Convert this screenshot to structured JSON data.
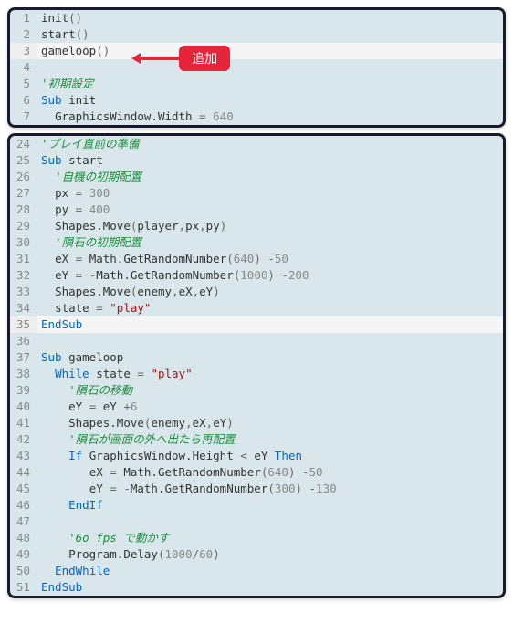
{
  "callout": {
    "label": "追加"
  },
  "top": [
    {
      "n": 1,
      "tokens": [
        [
          "fn",
          "init"
        ],
        [
          "op",
          "()"
        ]
      ]
    },
    {
      "n": 2,
      "tokens": [
        [
          "fn",
          "start"
        ],
        [
          "op",
          "()"
        ]
      ]
    },
    {
      "n": 3,
      "hl": true,
      "tokens": [
        [
          "fn",
          "gameloop"
        ],
        [
          "op",
          "()"
        ]
      ]
    },
    {
      "n": 4,
      "tokens": []
    },
    {
      "n": 5,
      "tokens": [
        [
          "cm",
          "'初期設定"
        ]
      ]
    },
    {
      "n": 6,
      "tokens": [
        [
          "kw",
          "Sub "
        ],
        [
          "fn",
          "init"
        ]
      ]
    },
    {
      "n": 7,
      "tokens": [
        [
          "p",
          "  "
        ],
        [
          "fn",
          "GraphicsWindow.Width "
        ],
        [
          "op",
          "= "
        ],
        [
          "num",
          "640"
        ]
      ]
    }
  ],
  "bottom": [
    {
      "n": 24,
      "tokens": [
        [
          "cm",
          "'プレイ直前の準備"
        ]
      ]
    },
    {
      "n": 25,
      "tokens": [
        [
          "kw",
          "Sub "
        ],
        [
          "fn",
          "start"
        ]
      ]
    },
    {
      "n": 26,
      "tokens": [
        [
          "p",
          "  "
        ],
        [
          "cm",
          "'自機の初期配置"
        ]
      ]
    },
    {
      "n": 27,
      "tokens": [
        [
          "p",
          "  "
        ],
        [
          "fn",
          "px "
        ],
        [
          "op",
          "= "
        ],
        [
          "num",
          "300"
        ]
      ]
    },
    {
      "n": 28,
      "tokens": [
        [
          "p",
          "  "
        ],
        [
          "fn",
          "py "
        ],
        [
          "op",
          "= "
        ],
        [
          "num",
          "400"
        ]
      ]
    },
    {
      "n": 29,
      "tokens": [
        [
          "p",
          "  "
        ],
        [
          "fn",
          "Shapes.Move"
        ],
        [
          "op",
          "("
        ],
        [
          "fn",
          "player"
        ],
        [
          "op",
          ","
        ],
        [
          "fn",
          "px"
        ],
        [
          "op",
          ","
        ],
        [
          "fn",
          "py"
        ],
        [
          "op",
          ")"
        ]
      ]
    },
    {
      "n": 30,
      "tokens": [
        [
          "p",
          "  "
        ],
        [
          "cm",
          "'隕石の初期配置"
        ]
      ]
    },
    {
      "n": 31,
      "tokens": [
        [
          "p",
          "  "
        ],
        [
          "fn",
          "eX "
        ],
        [
          "op",
          "= "
        ],
        [
          "fn",
          "Math.GetRandomNumber"
        ],
        [
          "op",
          "("
        ],
        [
          "num",
          "640"
        ],
        [
          "op",
          ") -"
        ],
        [
          "num",
          "50"
        ]
      ]
    },
    {
      "n": 32,
      "tokens": [
        [
          "p",
          "  "
        ],
        [
          "fn",
          "eY "
        ],
        [
          "op",
          "= -"
        ],
        [
          "fn",
          "Math.GetRandomNumber"
        ],
        [
          "op",
          "("
        ],
        [
          "num",
          "1000"
        ],
        [
          "op",
          ") -"
        ],
        [
          "num",
          "200"
        ]
      ]
    },
    {
      "n": 33,
      "tokens": [
        [
          "p",
          "  "
        ],
        [
          "fn",
          "Shapes.Move"
        ],
        [
          "op",
          "("
        ],
        [
          "fn",
          "enemy"
        ],
        [
          "op",
          ","
        ],
        [
          "fn",
          "eX"
        ],
        [
          "op",
          ","
        ],
        [
          "fn",
          "eY"
        ],
        [
          "op",
          ")"
        ]
      ]
    },
    {
      "n": 34,
      "tokens": [
        [
          "p",
          "  "
        ],
        [
          "fn",
          "state "
        ],
        [
          "op",
          "= "
        ],
        [
          "str",
          "\"play\""
        ]
      ]
    },
    {
      "n": 35,
      "hl": true,
      "tokens": [
        [
          "kw",
          "EndSub"
        ]
      ]
    },
    {
      "n": 36,
      "tokens": []
    },
    {
      "n": 37,
      "tokens": [
        [
          "kw",
          "Sub "
        ],
        [
          "fn",
          "gameloop"
        ]
      ]
    },
    {
      "n": 38,
      "tokens": [
        [
          "p",
          "  "
        ],
        [
          "kw",
          "While "
        ],
        [
          "fn",
          "state "
        ],
        [
          "op",
          "= "
        ],
        [
          "str",
          "\"play\""
        ]
      ]
    },
    {
      "n": 39,
      "tokens": [
        [
          "p",
          "    "
        ],
        [
          "cm",
          "'隕石の移動"
        ]
      ]
    },
    {
      "n": 40,
      "tokens": [
        [
          "p",
          "    "
        ],
        [
          "fn",
          "eY "
        ],
        [
          "op",
          "= "
        ],
        [
          "fn",
          "eY "
        ],
        [
          "op",
          "+"
        ],
        [
          "num",
          "6"
        ]
      ]
    },
    {
      "n": 41,
      "tokens": [
        [
          "p",
          "    "
        ],
        [
          "fn",
          "Shapes.Move"
        ],
        [
          "op",
          "("
        ],
        [
          "fn",
          "enemy"
        ],
        [
          "op",
          ","
        ],
        [
          "fn",
          "eX"
        ],
        [
          "op",
          ","
        ],
        [
          "fn",
          "eY"
        ],
        [
          "op",
          ")"
        ]
      ]
    },
    {
      "n": 42,
      "tokens": [
        [
          "p",
          "    "
        ],
        [
          "cm",
          "'隕石が画面の外へ出たら再配置"
        ]
      ]
    },
    {
      "n": 43,
      "tokens": [
        [
          "p",
          "    "
        ],
        [
          "kw",
          "If "
        ],
        [
          "fn",
          "GraphicsWindow.Height "
        ],
        [
          "op",
          "< "
        ],
        [
          "fn",
          "eY "
        ],
        [
          "kw",
          "Then"
        ]
      ]
    },
    {
      "n": 44,
      "tokens": [
        [
          "p",
          "       "
        ],
        [
          "fn",
          "eX "
        ],
        [
          "op",
          "= "
        ],
        [
          "fn",
          "Math.GetRandomNumber"
        ],
        [
          "op",
          "("
        ],
        [
          "num",
          "640"
        ],
        [
          "op",
          ") -"
        ],
        [
          "num",
          "50"
        ]
      ]
    },
    {
      "n": 45,
      "tokens": [
        [
          "p",
          "       "
        ],
        [
          "fn",
          "eY "
        ],
        [
          "op",
          "= -"
        ],
        [
          "fn",
          "Math.GetRandomNumber"
        ],
        [
          "op",
          "("
        ],
        [
          "num",
          "300"
        ],
        [
          "op",
          ") -"
        ],
        [
          "num",
          "130"
        ]
      ]
    },
    {
      "n": 46,
      "tokens": [
        [
          "p",
          "    "
        ],
        [
          "kw",
          "EndIf"
        ]
      ]
    },
    {
      "n": 47,
      "tokens": []
    },
    {
      "n": 48,
      "tokens": [
        [
          "p",
          "    "
        ],
        [
          "cm",
          "'6o fps で動かす"
        ]
      ]
    },
    {
      "n": 49,
      "tokens": [
        [
          "p",
          "    "
        ],
        [
          "fn",
          "Program.Delay"
        ],
        [
          "op",
          "("
        ],
        [
          "num",
          "1000"
        ],
        [
          "op",
          "/"
        ],
        [
          "num",
          "60"
        ],
        [
          "op",
          ")"
        ]
      ]
    },
    {
      "n": 50,
      "tokens": [
        [
          "p",
          "  "
        ],
        [
          "kw",
          "EndWhile"
        ]
      ]
    },
    {
      "n": 51,
      "tokens": [
        [
          "kw",
          "EndSub"
        ]
      ]
    }
  ]
}
